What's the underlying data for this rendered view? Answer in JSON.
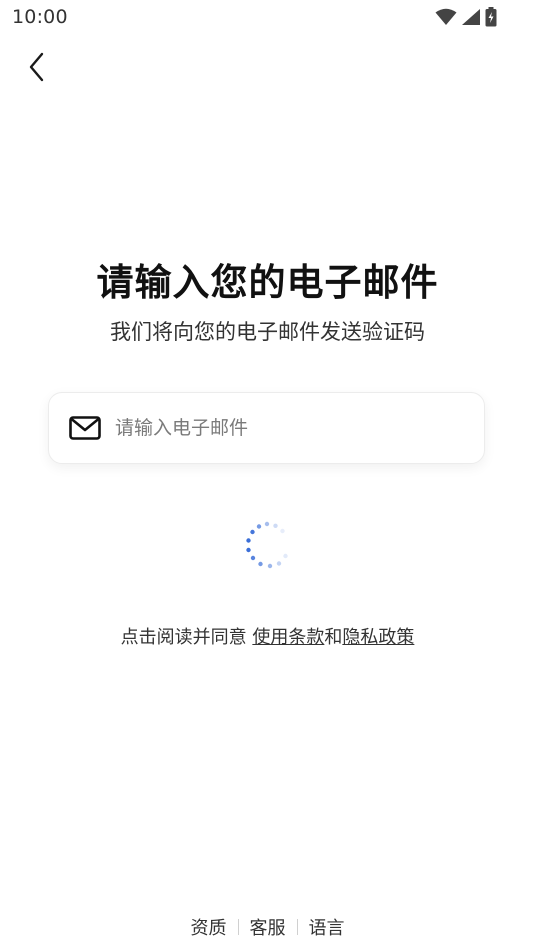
{
  "status_bar": {
    "time": "10:00"
  },
  "header": {
    "back_icon": "chevron-left-icon"
  },
  "main": {
    "title": "请输入您的电子邮件",
    "subtitle": "我们将向您的电子邮件发送验证码",
    "email_field": {
      "icon": "mail-icon",
      "value": "",
      "placeholder": "请输入电子邮件"
    },
    "agreement": {
      "prefix": "点击阅读并同意 ",
      "terms_link": "使用条款",
      "conjunction": "和",
      "privacy_link": "隐私政策"
    }
  },
  "footer": {
    "items": [
      "资质",
      "客服",
      "语言"
    ]
  },
  "colors": {
    "accent": "#3b6fd8",
    "text_primary": "#111111",
    "text_secondary": "#333333",
    "placeholder": "#7a7a7a"
  }
}
